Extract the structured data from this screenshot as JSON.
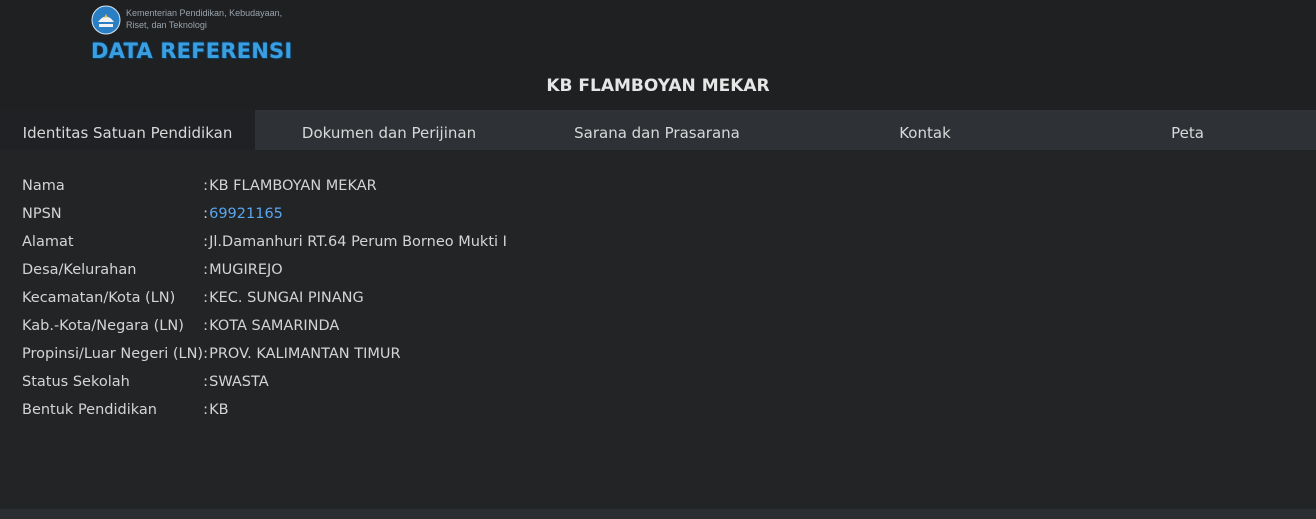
{
  "header": {
    "ministry_line1": "Kementerian Pendidikan, Kebudayaan,",
    "ministry_line2": "Riset, dan Teknologi",
    "brand": "DATA REFERENSI",
    "school_name": "KB FLAMBOYAN MEKAR"
  },
  "tabs": [
    {
      "label": "Identitas Satuan Pendidikan",
      "active": true
    },
    {
      "label": "Dokumen dan Perijinan",
      "active": false
    },
    {
      "label": "Sarana dan Prasarana",
      "active": false
    },
    {
      "label": "Kontak",
      "active": false
    },
    {
      "label": "Peta",
      "active": false
    }
  ],
  "identity": {
    "separator": ":",
    "rows": [
      {
        "label": "Nama",
        "value": "KB FLAMBOYAN MEKAR"
      },
      {
        "label": "NPSN",
        "value": "69921165"
      },
      {
        "label": "Alamat",
        "value": "Jl.Damanhuri RT.64 Perum Borneo Mukti I"
      },
      {
        "label": "Desa/Kelurahan",
        "value": "MUGIREJO"
      },
      {
        "label": "Kecamatan/Kota (LN)",
        "value": "KEC. SUNGAI PINANG"
      },
      {
        "label": "Kab.-Kota/Negara (LN)",
        "value": "KOTA SAMARINDA"
      },
      {
        "label": "Propinsi/Luar Negeri (LN)",
        "value": "PROV. KALIMANTAN TIMUR"
      },
      {
        "label": "Status Sekolah",
        "value": "SWASTA"
      },
      {
        "label": "Bentuk Pendidikan",
        "value": "KB"
      }
    ]
  },
  "colors": {
    "background": "#1e2022",
    "tab_bar": "#2e3237",
    "link": "#5aa6f0",
    "brand": "#3a9fe0"
  }
}
